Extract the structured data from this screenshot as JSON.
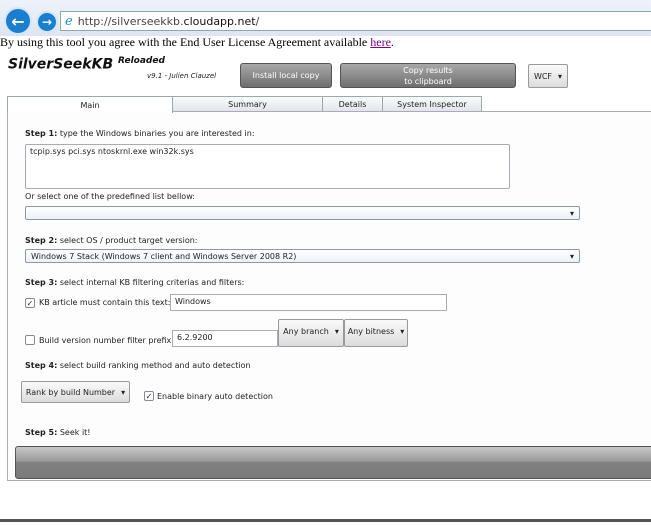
{
  "browser": {
    "url_prefix": "http://silverseekkb.",
    "url_domain": "cloudapp.net",
    "url_suffix": "/"
  },
  "eula": {
    "text": "By using this tool you agree with the End User License Agreement available ",
    "link": "here",
    "end": "."
  },
  "app": {
    "title": "SilverSeekKB",
    "title_sup": "Reloaded",
    "version": "v9.1 - Julien Clauzel"
  },
  "toolbar": {
    "install": "Install local copy",
    "copy_line1": "Copy results",
    "copy_line2": "to clipboard",
    "transport": "WCF"
  },
  "tabs": [
    "Main",
    "Summary",
    "Details",
    "System Inspector"
  ],
  "step1": {
    "label": "Step 1:",
    "text": " type the Windows binaries you are interested in:",
    "value": "tcpip.sys pci.sys ntoskrnl.exe win32k.sys",
    "predefined_label": "Or select one of the predefined list bellow:",
    "predefined_value": ""
  },
  "step2": {
    "label": "Step 2:",
    "text": " select OS / product target version:",
    "value": "Windows 7 Stack (Windows 7 client and Windows Server 2008 R2)"
  },
  "step3": {
    "label": "Step 3:",
    "text": " select internal KB filtering criterias and filters:",
    "kb_check_label": "KB article must contain this text:",
    "kb_checked": true,
    "kb_value": "Windows",
    "build_check_label": "Build version number filter prefix:",
    "build_checked": false,
    "build_value": "6.2.9200",
    "branch": "Any branch",
    "bitness": "Any bitness"
  },
  "step4": {
    "label": "Step 4:",
    "text": " select build ranking method and auto detection",
    "rank": "Rank by build Number",
    "auto_label": "Enable binary auto detection",
    "auto_checked": true
  },
  "step5": {
    "label": "Step 5:",
    "text": " Seek it!"
  }
}
